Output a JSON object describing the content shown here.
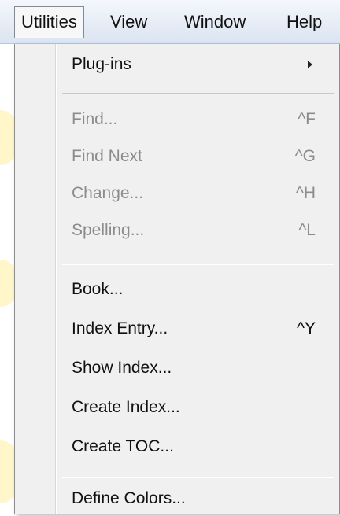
{
  "menubar": {
    "items": [
      {
        "label": "Utilities",
        "active": true
      },
      {
        "label": "View",
        "active": false
      },
      {
        "label": "Window",
        "active": false
      },
      {
        "label": "Help",
        "active": false
      }
    ]
  },
  "dropdown": {
    "items": [
      {
        "label": "Plug-ins",
        "shortcut": "",
        "disabled": false,
        "submenu": true
      },
      {
        "label": "Find...",
        "shortcut": "^F",
        "disabled": true
      },
      {
        "label": "Find Next",
        "shortcut": "^G",
        "disabled": true
      },
      {
        "label": "Change...",
        "shortcut": "^H",
        "disabled": true
      },
      {
        "label": "Spelling...",
        "shortcut": "^L",
        "disabled": true
      },
      {
        "label": "Book...",
        "shortcut": "",
        "disabled": false
      },
      {
        "label": "Index Entry...",
        "shortcut": "^Y",
        "disabled": false
      },
      {
        "label": "Show Index...",
        "shortcut": "",
        "disabled": false
      },
      {
        "label": "Create Index...",
        "shortcut": "",
        "disabled": false
      },
      {
        "label": "Create TOC...",
        "shortcut": "",
        "disabled": false
      },
      {
        "label": "Define Colors...",
        "shortcut": "",
        "disabled": false
      }
    ]
  }
}
